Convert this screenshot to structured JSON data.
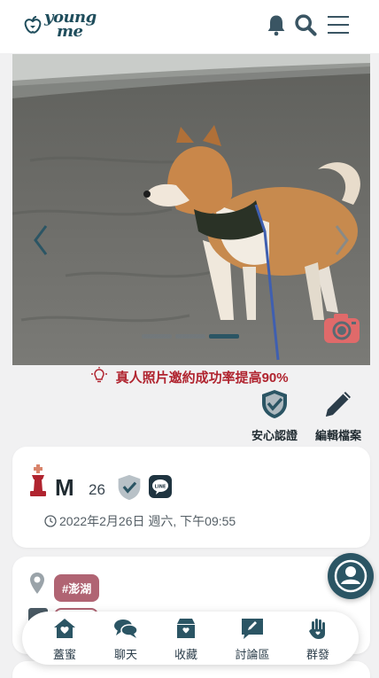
{
  "header": {
    "logo_line1": "young",
    "logo_line2": "me",
    "icons": [
      "bell-icon",
      "search-icon",
      "menu-icon"
    ]
  },
  "photo": {
    "carousel_pages": 3,
    "current_page": 3
  },
  "tip": {
    "text": "真人照片邀約成功率提高90%"
  },
  "actions": {
    "verify_label": "安心認證",
    "edit_label": "編輯檔案"
  },
  "profile": {
    "name": "M",
    "age": "26",
    "datetime": "2022年2月26日 週六, 下午09:55"
  },
  "location": {
    "tag": "#澎湖"
  },
  "nav": {
    "items": [
      {
        "label": "蓋蜜",
        "icon": "home-icon"
      },
      {
        "label": "聊天",
        "icon": "chat-icon"
      },
      {
        "label": "收藏",
        "icon": "box-heart-icon"
      },
      {
        "label": "討論區",
        "icon": "forum-edit-icon"
      },
      {
        "label": "群發",
        "icon": "hand-icon"
      }
    ]
  },
  "colors": {
    "primary": "#2b5564",
    "accent_red": "#b0242f",
    "tag_bg": "#b06473",
    "camera": "#e06a6a"
  }
}
